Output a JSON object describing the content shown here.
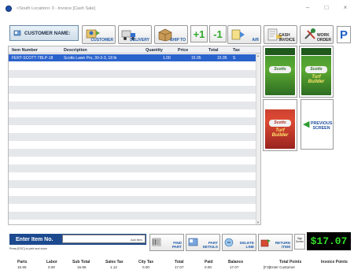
{
  "window": {
    "title": "<South Location> 3 - Invoice [Cash Sale]",
    "controls": [
      "–",
      "□",
      "×"
    ]
  },
  "toolbar": {
    "customer_label": "CUSTOMER NAME:",
    "customer_btn": "CUSTOMER",
    "delivery_btn": "DELIVERY",
    "ship_to_btn": "SHIP TO",
    "plus_one": "+1",
    "minus_one": "-1",
    "ar_btn": "A/R",
    "cash_invoice_line1": "CASH",
    "cash_invoice_line2": "INVOICE",
    "work_order_line1": "WORK",
    "work_order_line2": "ORDER",
    "p_btn": "P"
  },
  "grid": {
    "columns": [
      "Item Number",
      "Description",
      "Quantity",
      "Price",
      "Total",
      "Tax"
    ],
    "rows": [
      {
        "item_number": "FERT-SCOTT-TBLP-18",
        "description": "Scotts Lawn Pro, 30-3-3, 18 lb",
        "quantity": "1.00",
        "price": "15.95",
        "total": "15.95",
        "tax": "S"
      }
    ]
  },
  "tiles": {
    "brand": "Scotts",
    "product": "Turf Builder",
    "previous_screen_line1": "PREVIOUS",
    "previous_screen_line2": "SCREEN"
  },
  "entry": {
    "label": "Enter Item No.",
    "value": "",
    "note": "Press [ESC] to print and close",
    "add_item": "Add Item"
  },
  "bottom_buttons": {
    "find_part_line1": "FIND",
    "find_part_line2": "PART",
    "part_details_line1": "PART",
    "part_details_line2": "DETAILS",
    "delete_line_line1": "DELETE",
    "delete_line_line2": "LINE",
    "return_item_line1": "RETURN",
    "return_item_line2": "ITEM",
    "sign_line1": "Sign",
    "sign_line2": "Screen"
  },
  "total_display": "$17.07",
  "summary": {
    "parts_label": "Parts",
    "parts": "15.95",
    "labor_label": "Labor",
    "labor": "0.00",
    "subtotal_label": "Sub Total",
    "subtotal": "15.95",
    "sales_tax_label": "Sales Tax",
    "sales_tax": "1.12",
    "city_tax_label": "City Tax",
    "city_tax": "0.00",
    "total_label": "Total",
    "total": "17.07",
    "paid_label": "Paid",
    "paid": "0.00",
    "balance_label": "Balance",
    "balance": "17.07",
    "total_points_label": "Total Points",
    "total_points": "[F3]Enter Customer",
    "invoice_points_label": "Invoice Points"
  },
  "colors": {
    "selected_row": "#2a62cc",
    "entry_bar": "#1d4a8f",
    "total_text": "#33e02a",
    "total_bg": "#000000"
  }
}
